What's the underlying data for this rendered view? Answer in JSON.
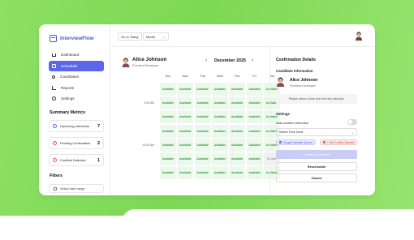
{
  "app": {
    "name": "InterviewFlow"
  },
  "sidebar": {
    "items": [
      {
        "label": "Dashboard",
        "icon": "home-icon",
        "active": false
      },
      {
        "label": "Scheduler",
        "icon": "calendar-icon",
        "active": true
      },
      {
        "label": "Candidates",
        "icon": "people-icon",
        "active": false
      },
      {
        "label": "Reports",
        "icon": "chart-icon",
        "active": false
      },
      {
        "label": "Settings",
        "icon": "gear-icon",
        "active": false
      }
    ],
    "metrics_title": "Summary Metrics",
    "metrics": [
      {
        "label": "Upcoming Interviews",
        "value": "7",
        "color": "#5b67e8"
      },
      {
        "label": "Pending Confirmation",
        "value": "2",
        "color": "#e05555"
      },
      {
        "label": "Conflicts Detected",
        "value": "1",
        "color": "#e05555"
      }
    ],
    "filters_title": "Filters",
    "date_range_placeholder": "Select date range"
  },
  "toolbar": {
    "goto_today": "Go to Today",
    "view": "Month"
  },
  "calendar": {
    "doctor_name": "Alice Johnson",
    "doctor_role": "Frontend Developer",
    "month": "December 2025",
    "days": [
      "Sun",
      "Mon",
      "Tue",
      "Wed",
      "Thu",
      "Fri",
      "Sat"
    ],
    "rows": [
      {
        "time": "",
        "cells": [
          "Available",
          "Available",
          "Available",
          "Available",
          "Available",
          "Available",
          "Available"
        ]
      },
      {
        "time": "9:00 AM",
        "cells": [
          "Available",
          "Available",
          "Available",
          "Available",
          "Available",
          "Available",
          "Available"
        ]
      },
      {
        "time": "",
        "cells": [
          "Available",
          "Available",
          "Available",
          "Available",
          "Available",
          "Available",
          "Available"
        ]
      },
      {
        "time": "",
        "cells": [
          "Available",
          "Available",
          "Available",
          "Available",
          "Available",
          "Available",
          "Available"
        ]
      },
      {
        "time": "10:00 AM",
        "cells": [
          "Available",
          "Available",
          "Available",
          "Available",
          "Available",
          "Available",
          "Available"
        ]
      },
      {
        "time": "",
        "cells": [
          "Available",
          "Available",
          "Available",
          "Available",
          "Available",
          "Available",
          "Booked"
        ]
      },
      {
        "time": "",
        "cells": [
          "Available",
          "Available",
          "Available",
          "Available",
          "Available",
          "Available",
          "Available"
        ]
      }
    ]
  },
  "panel": {
    "title": "Confirmation Details",
    "candidate_section": "Candidate Information",
    "candidate_name": "Alice Johnson",
    "candidate_role": "Frontend Developer",
    "hint": "Please select a time slot from the calendar.",
    "settings_title": "Settings",
    "auto_confirm_label": "Auto-confirm Interview",
    "auto_confirm_on": false,
    "timezone_placeholder": "Select Time Zone",
    "badge_sync": "Google Calendar Synced",
    "badge_conflict": "1 Slot Conflict Detected",
    "confirm_label": "Confirm Schedule",
    "reschedule_label": "Reschedule",
    "cancel_label": "Cancel"
  }
}
